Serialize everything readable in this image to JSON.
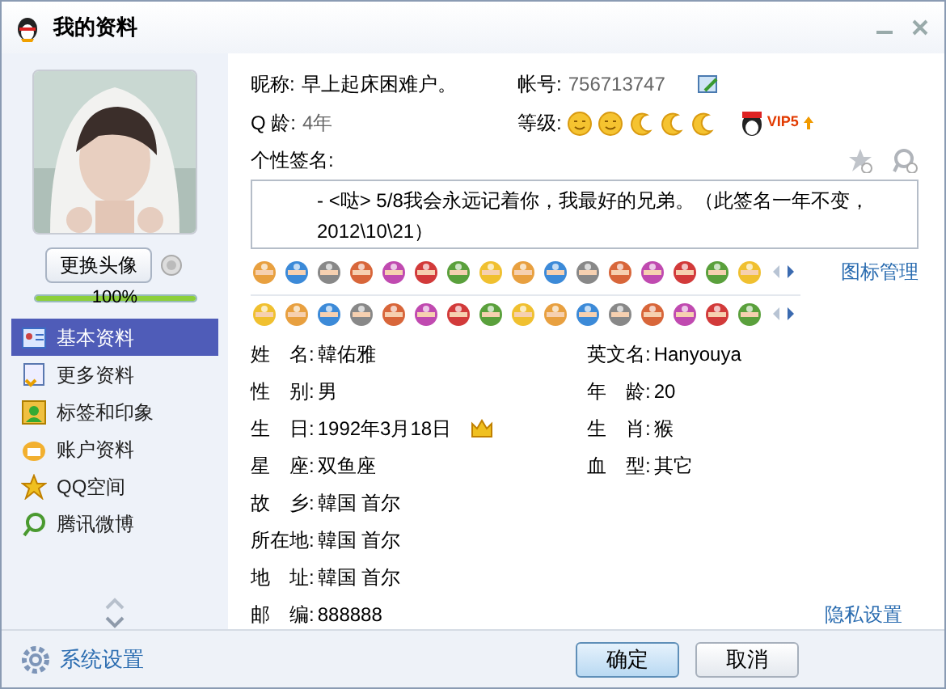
{
  "window": {
    "title": "我的资料"
  },
  "change_avatar_button": "更换头像",
  "completion": {
    "level": 1,
    "reading": "100%"
  },
  "nav": [
    {
      "label": "基本资料",
      "selected": true
    },
    {
      "label": "更多资料",
      "selected": false
    },
    {
      "label": "标签和印象",
      "selected": false
    },
    {
      "label": "账户资料",
      "selected": false
    },
    {
      "label": "QQ空间",
      "selected": false
    },
    {
      "label": "腾讯微博",
      "selected": false
    }
  ],
  "system_settings": "系统设置",
  "profile": {
    "nickname_label": "昵称:",
    "nickname": "早上起床困难户。",
    "account_label": "帐号:",
    "account": "756713747",
    "qage_label": "Q 龄:",
    "qage": "4年",
    "level_label": "等级:",
    "level_icons": [
      {
        "kind": "sun"
      },
      {
        "kind": "sun"
      },
      {
        "kind": "moon"
      },
      {
        "kind": "moon"
      },
      {
        "kind": "moon"
      }
    ],
    "vip_badge": "VIP5",
    "signature_label": "个性签名:",
    "signature": "- <哒> 5/8我会永远记着你，我最好的兄弟。（此签名一年不变，2012\\10\\21）"
  },
  "icon_manage_link": "图标管理",
  "details_left": [
    {
      "label": "姓　名:",
      "value": "韓佑雅",
      "kind": "text"
    },
    {
      "label": "性　别:",
      "value": "男",
      "kind": "text"
    },
    {
      "label": "生　日:",
      "value": "1992年3月18日",
      "kind": "birthday"
    },
    {
      "label": "星　座:",
      "value": "双鱼座",
      "kind": "text"
    },
    {
      "label": "故　乡:",
      "value": "韓国 首尔",
      "kind": "text"
    },
    {
      "label": "所在地:",
      "value": "韓国 首尔",
      "kind": "text"
    },
    {
      "label": "地　址:",
      "value": "韓国 首尔",
      "kind": "text"
    },
    {
      "label": "邮　编:",
      "value": "888888",
      "kind": "text"
    }
  ],
  "details_right": [
    {
      "label": "英文名:",
      "value": "Hanyouya"
    },
    {
      "label": "年　龄:",
      "value": "20"
    },
    {
      "label": "生　肖:",
      "value": "猴"
    },
    {
      "label": "血　型:",
      "value": "其它"
    }
  ],
  "privacy_link": "隐私设置",
  "buttons": [
    {
      "label": "确定",
      "kind": "primary"
    },
    {
      "label": "取消",
      "kind": "default"
    }
  ]
}
